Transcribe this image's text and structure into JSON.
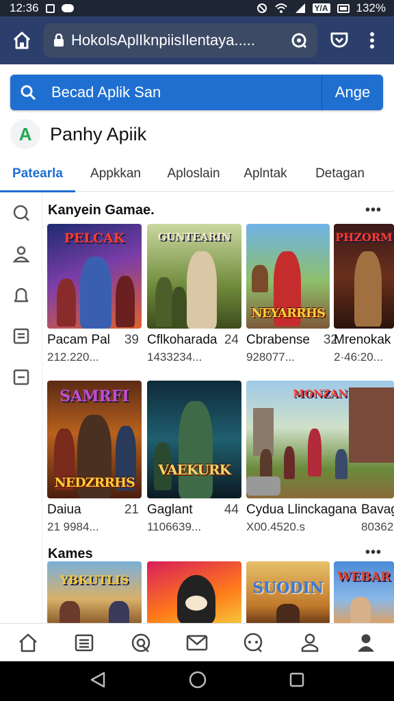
{
  "status_bar": {
    "time": "12:36",
    "battery": "132%",
    "box_label": "Y/A"
  },
  "browser": {
    "url": "HokolsAplIknpiisIlentaya....."
  },
  "search": {
    "placeholder": "Becad Aplik San",
    "button_label": "Ange"
  },
  "app": {
    "logo_letter": "A",
    "title": "Panhy Apiik"
  },
  "tabs": [
    {
      "label": "Patearla",
      "active": true
    },
    {
      "label": "Appkkan"
    },
    {
      "label": "Aploslain"
    },
    {
      "label": "Aplntak"
    },
    {
      "label": "Detagan"
    }
  ],
  "sections": [
    {
      "title": "Kanyein Gamae.",
      "more": "•••"
    },
    {
      "title": "Kames",
      "more": "•••"
    }
  ],
  "row1": [
    {
      "name": "Pacam Pal",
      "rank": "39",
      "sub": "212.220...",
      "art_title": "PELCAK",
      "art_sub": ""
    },
    {
      "name": "Cflkoharada",
      "rank": "24",
      "sub": "1433234...",
      "art_title": "GUNTEARIN",
      "art_sub": ""
    },
    {
      "name": "Cbrabense",
      "rank": "32",
      "sub": "928077...",
      "art_title": "NEYARRHS",
      "art_sub": ""
    },
    {
      "name": "Mrenokak",
      "rank": "",
      "sub": "2·46:20...",
      "art_title": "PHZORM",
      "art_sub": ""
    }
  ],
  "row2": [
    {
      "name": "Daiua",
      "rank": "21",
      "sub": "21 9984...",
      "art_title": "NEDZRRHS",
      "top_title": "SAMRFI"
    },
    {
      "name": "Gaglant",
      "rank": "44",
      "sub": "1106639...",
      "art_title": "VAEKURK",
      "top_title": ""
    },
    {
      "name": "Cydua Llinckagana",
      "rank": "",
      "sub": "X00.4520.s",
      "art_title": "",
      "top_title": "MONZAN"
    },
    {
      "name": "Bavag",
      "rank": "",
      "sub": "80362",
      "art_title": "",
      "top_title": ""
    }
  ],
  "row3": [
    {
      "art_title": "YBKUTLIS"
    },
    {
      "art_title": ""
    },
    {
      "art_title": "SUODIN"
    },
    {
      "art_title": "WEBAR"
    }
  ]
}
